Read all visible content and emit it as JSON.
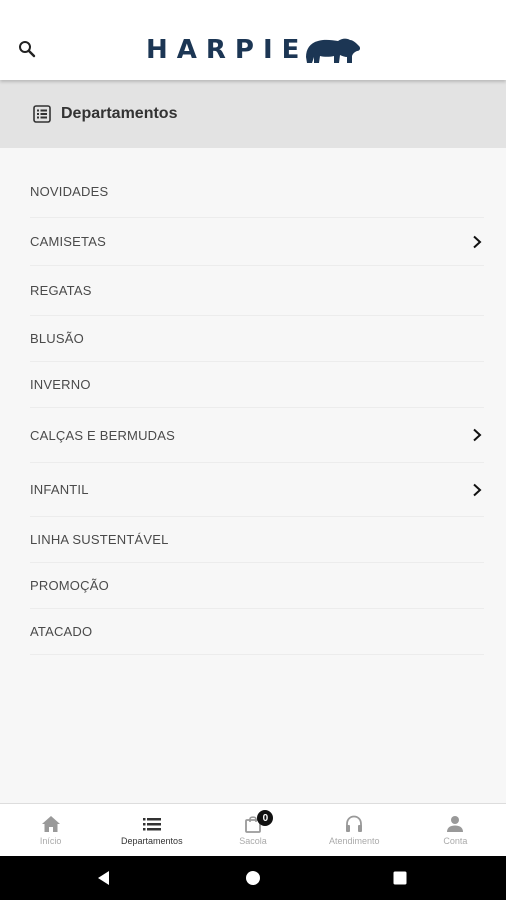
{
  "header": {
    "brand": "HARPIE",
    "brand_color": "#1c3654"
  },
  "departments": {
    "title": "Departamentos",
    "items": [
      {
        "label": "NOVIDADES",
        "has_children": false
      },
      {
        "label": "CAMISETAS",
        "has_children": true
      },
      {
        "label": "REGATAS",
        "has_children": false
      },
      {
        "label": "BLUSÃO",
        "has_children": false
      },
      {
        "label": "INVERNO",
        "has_children": false
      },
      {
        "label": "CALÇAS E BERMUDAS",
        "has_children": true
      },
      {
        "label": "INFANTIL",
        "has_children": true
      },
      {
        "label": "LINHA SUSTENTÁVEL",
        "has_children": false
      },
      {
        "label": "PROMOÇÃO",
        "has_children": false
      },
      {
        "label": "ATACADO",
        "has_children": false
      }
    ]
  },
  "bottom_nav": {
    "items": [
      {
        "label": "Início",
        "icon": "home-icon",
        "active": false
      },
      {
        "label": "Departamentos",
        "icon": "list-icon",
        "active": true
      },
      {
        "label": "Sacola",
        "icon": "bag-icon",
        "active": false,
        "badge": "0"
      },
      {
        "label": "Atendimento",
        "icon": "headphones-icon",
        "active": false
      },
      {
        "label": "Conta",
        "icon": "person-icon",
        "active": false
      }
    ]
  },
  "system_nav": {
    "buttons": [
      "back-icon",
      "home-circle-icon",
      "recents-icon"
    ]
  }
}
